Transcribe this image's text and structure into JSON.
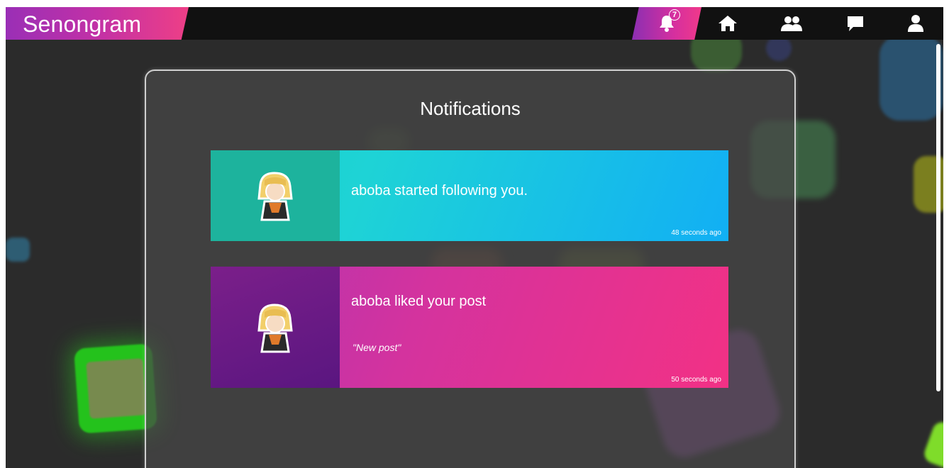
{
  "app": {
    "title": "Senongram",
    "brand_gradient": [
      "#9a2fb6",
      "#ee3f86"
    ]
  },
  "navbar": {
    "notifications_badge": "7",
    "icons": [
      "bell-icon",
      "home-icon",
      "friends-icon",
      "chat-icon",
      "user-icon"
    ]
  },
  "panel": {
    "title": "Notifications"
  },
  "notifications": [
    {
      "text": "aboba started following you.",
      "time": "48 seconds ago",
      "accent": "#12aff4"
    },
    {
      "text": "aboba liked your post",
      "quote": "\"New post\"",
      "time": "50 seconds ago",
      "accent": "#f23185"
    }
  ]
}
